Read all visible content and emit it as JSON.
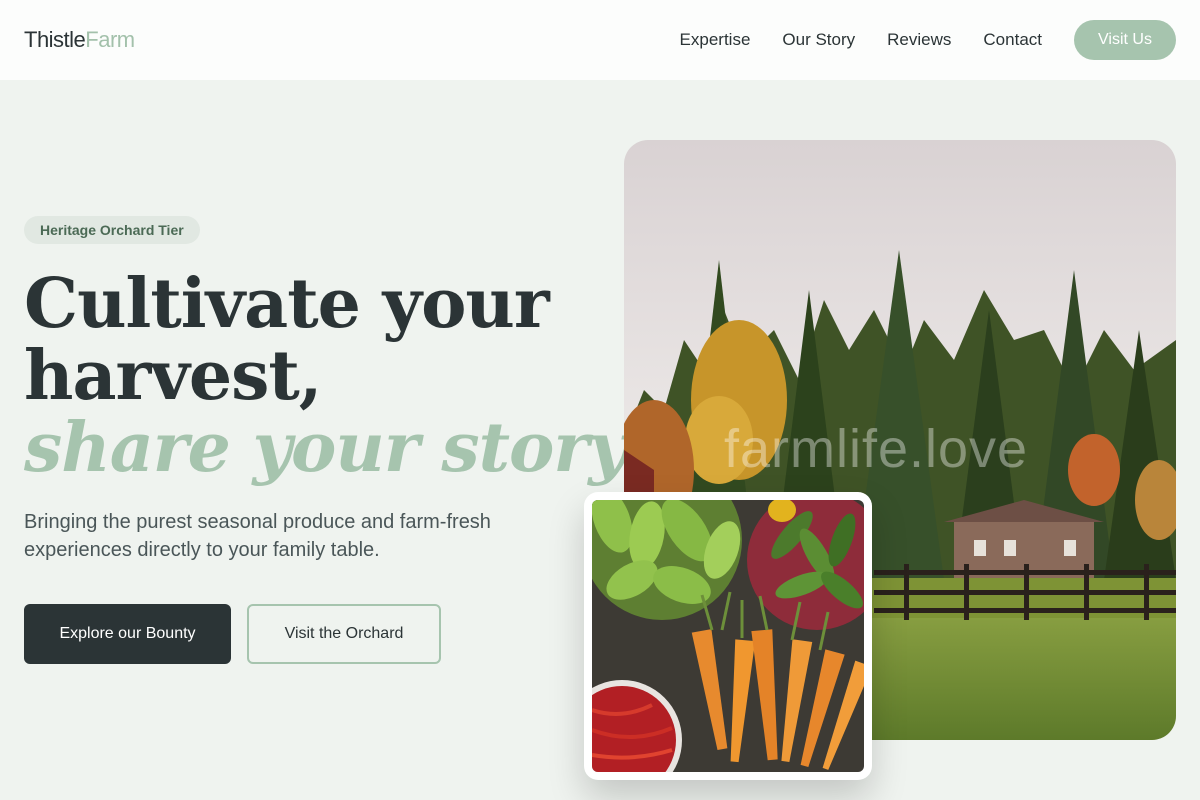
{
  "brand": {
    "name_first": "Thistle",
    "name_second": "Farm"
  },
  "nav": {
    "links": [
      "Expertise",
      "Our Story",
      "Reviews",
      "Contact"
    ],
    "cta_label": "Visit Us"
  },
  "hero": {
    "badge": "Heritage Orchard Tier",
    "headline_line1": "Cultivate your",
    "headline_line2": "harvest,",
    "headline_accent": "share your story.",
    "subtitle": "Bringing the purest seasonal produce and farm-fresh experiences directly to your family table.",
    "primary_cta": "Explore our Bounty",
    "secondary_cta": "Visit the Orchard",
    "photo_watermark": "farmlife.love"
  },
  "colors": {
    "accent": "#a6c4ae",
    "dark": "#2b3436",
    "background": "#eff3ef"
  }
}
